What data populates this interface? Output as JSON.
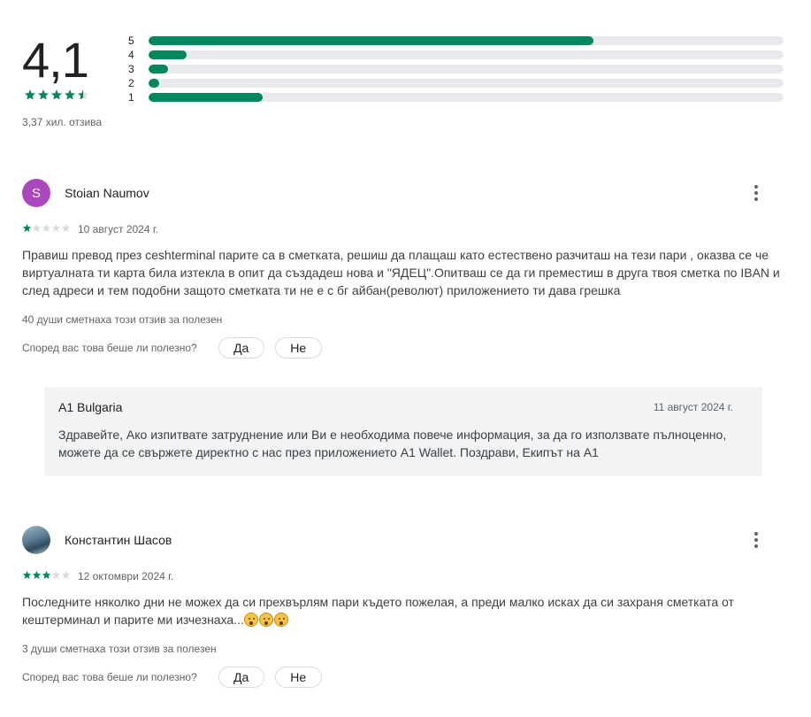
{
  "summary": {
    "score": "4,1",
    "stars": [
      1,
      1,
      1,
      1,
      0.5
    ],
    "count_text": "3,37 хил. отзива",
    "distribution": [
      {
        "label": "5",
        "fraction": 0.7
      },
      {
        "label": "4",
        "fraction": 0.06
      },
      {
        "label": "3",
        "fraction": 0.03
      },
      {
        "label": "2",
        "fraction": 0.017
      },
      {
        "label": "1",
        "fraction": 0.18
      }
    ]
  },
  "colors": {
    "accent": "#01875f",
    "track": "#e8eaed",
    "empty_star": "#dadce0"
  },
  "reviews": [
    {
      "author": "Stoian Naumov",
      "avatar_letter": "S",
      "rating": 1,
      "date": "10 август 2024 г.",
      "text": "Правиш превод през ceshterminal парите са в сметката, решиш да плащаш като естествено разчиташ на тези пари , оказва се че виртуалната ти карта била изтекла в опит да създадеш нова и \"ЯДЕЦ\".Опитваш се да ги преместиш в друга твоя сметка по IBAN и след адреси и тем подобни защото сметката ти не е с бг айбан(револют) приложението ти дава грешка",
      "helpful": "40 души сметнаха този отзив за полезен",
      "ask": "Според вас това беше ли полезно?",
      "yes": "Да",
      "no": "Не",
      "reply": {
        "name": "A1 Bulgaria",
        "date": "11 август 2024 г.",
        "text": "Здравейте, Ако изпитвате затруднение или Ви е необходима повече информация, за да го използвате пълноценно, можете да се свържете директно с нас през приложението A1 Wallet. Поздрави, Екипът на A1"
      }
    },
    {
      "author": "Константин Шасов",
      "rating": 3,
      "date": "12 октомври 2024 г.",
      "text": "Последните няколко дни не можех да си прехвърлям пари където пожелая, а преди малко исках да си захраня сметката от кештерминал и парите ми изчезнаха...",
      "emojis": [
        "astonished-face",
        "astonished-face",
        "astonished-face"
      ],
      "helpful": "3 души сметнаха този отзив за полезен",
      "ask": "Според вас това беше ли полезно?",
      "yes": "Да",
      "no": "Не"
    }
  ]
}
